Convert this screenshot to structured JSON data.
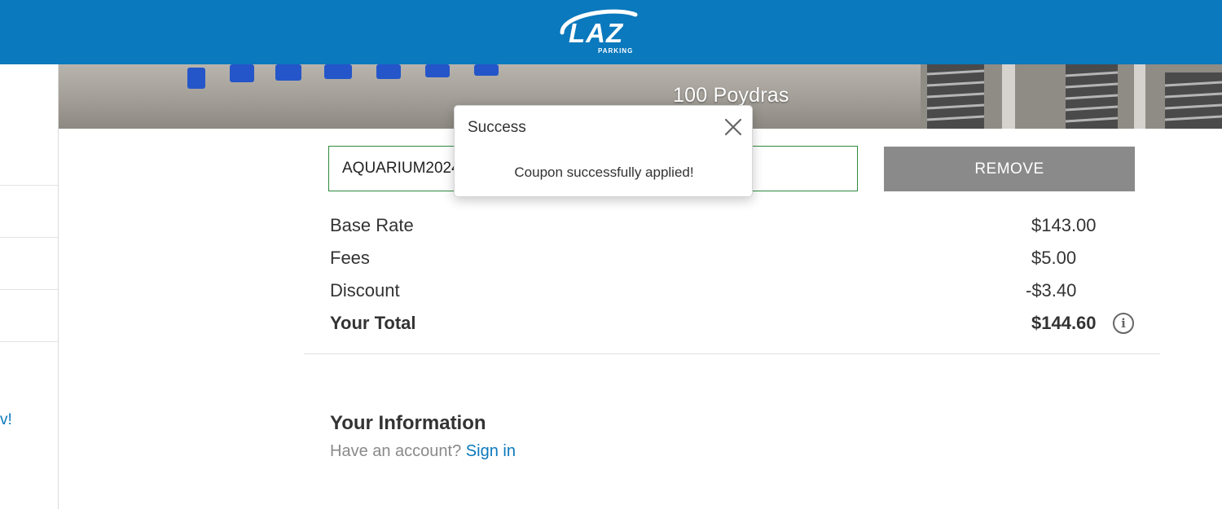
{
  "header": {
    "logo_text": "LAZ",
    "logo_subtext": "PARKING",
    "brand_color": "#0a79bd"
  },
  "sidebar": {
    "partial_link_text": "v!"
  },
  "hero": {
    "location_name": "100 Poydras"
  },
  "coupon": {
    "code_value": "AQUARIUM2024",
    "remove_label": "REMOVE",
    "accent_color": "#2e8b3e"
  },
  "pricing": {
    "rows": [
      {
        "label": "Base Rate",
        "value": "$143.00"
      },
      {
        "label": "Fees",
        "value": "$5.00"
      },
      {
        "label": "Discount",
        "value": "-$3.40"
      }
    ],
    "total": {
      "label": "Your Total",
      "value": "$144.60"
    },
    "info_icon": "info-circle-icon"
  },
  "your_information": {
    "heading": "Your Information",
    "prompt": "Have an account?",
    "sign_in_label": "Sign in"
  },
  "popup": {
    "title": "Success",
    "message": "Coupon successfully applied!",
    "close_icon": "close-icon"
  }
}
